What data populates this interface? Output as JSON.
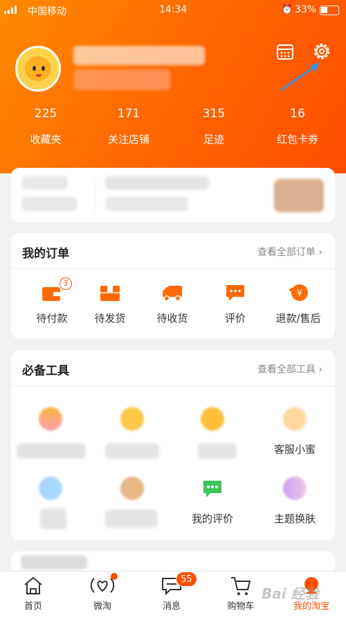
{
  "status_bar": {
    "carrier": "中国移动",
    "time": "14:34",
    "battery": "33%",
    "network": "4G"
  },
  "profile": {
    "avatar": "avatar-duck",
    "calendar_icon": "calendar-icon",
    "settings_icon": "gear-icon"
  },
  "stats": [
    {
      "value": "225",
      "label": "收藏夹"
    },
    {
      "value": "171",
      "label": "关注店铺"
    },
    {
      "value": "315",
      "label": "足迹"
    },
    {
      "value": "16",
      "label": "红包卡券"
    }
  ],
  "orders": {
    "title": "我的订单",
    "more": "查看全部订单 ›",
    "items": [
      {
        "label": "待付款",
        "icon": "wallet-icon",
        "badge": "3"
      },
      {
        "label": "待发货",
        "icon": "package-icon"
      },
      {
        "label": "待收货",
        "icon": "truck-icon"
      },
      {
        "label": "评价",
        "icon": "comment-icon"
      },
      {
        "label": "退款/售后",
        "icon": "refund-icon"
      }
    ]
  },
  "tools": {
    "title": "必备工具",
    "more": "查看全部工具 ›",
    "items": [
      {
        "label": "",
        "icon": "tool-icon"
      },
      {
        "label": "",
        "icon": "tool-icon"
      },
      {
        "label": "",
        "icon": "tool-icon"
      },
      {
        "label": "客服小蜜",
        "icon": "service-icon"
      },
      {
        "label": "",
        "icon": "tool-icon"
      },
      {
        "label": "",
        "icon": "tool-icon"
      },
      {
        "label": "我的评价",
        "icon": "my-review-icon"
      },
      {
        "label": "主题换肤",
        "icon": "theme-icon"
      }
    ]
  },
  "tabbar": [
    {
      "label": "首页",
      "icon": "home-icon"
    },
    {
      "label": "微淘",
      "icon": "weitao-icon"
    },
    {
      "label": "消息",
      "icon": "message-icon",
      "badge": "55"
    },
    {
      "label": "购物车",
      "icon": "cart-icon"
    },
    {
      "label": "我的淘宝",
      "icon": "my-taobao-icon"
    }
  ],
  "watermark": "Bai 经验",
  "colors": {
    "accent": "#ff5000",
    "header_start": "#ff8a00",
    "header_end": "#ff4d00"
  }
}
